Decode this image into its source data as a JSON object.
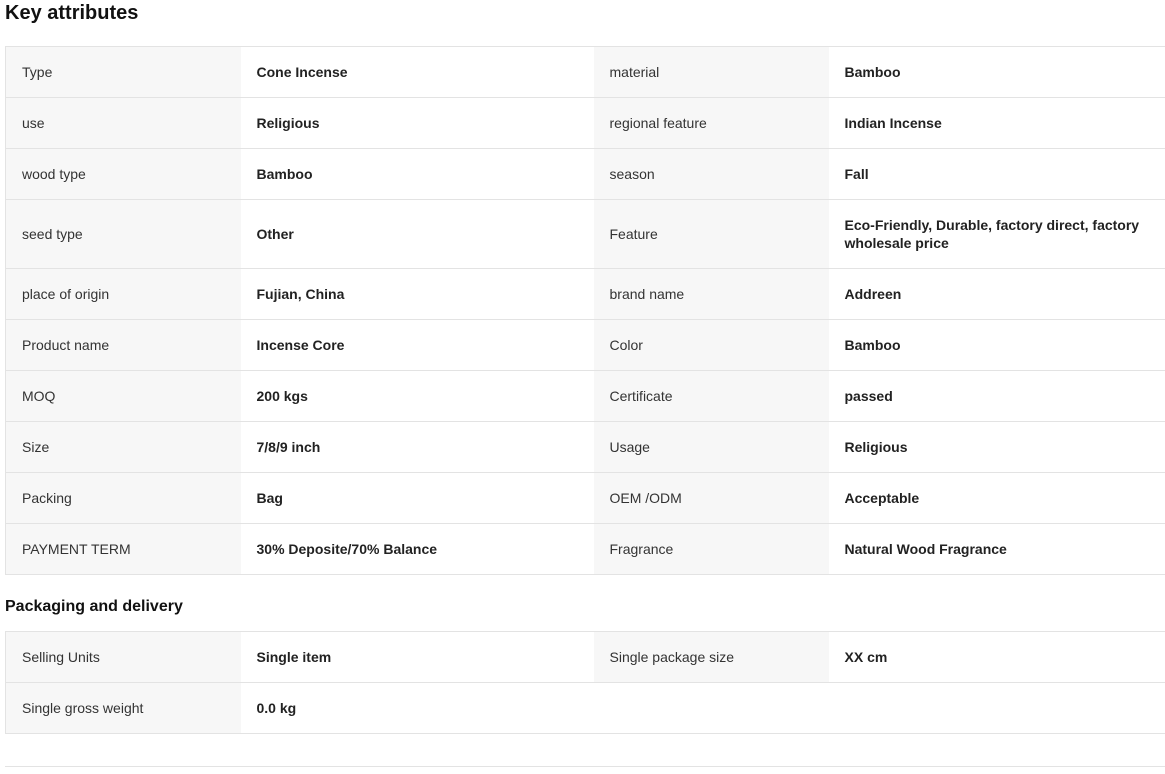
{
  "key_attributes": {
    "title": "Key attributes",
    "rows": [
      {
        "label1": "Type",
        "value1": "Cone Incense",
        "label2": "material",
        "value2": "Bamboo"
      },
      {
        "label1": "use",
        "value1": "Religious",
        "label2": "regional feature",
        "value2": "Indian Incense"
      },
      {
        "label1": "wood type",
        "value1": "Bamboo",
        "label2": "season",
        "value2": "Fall"
      },
      {
        "label1": "seed type",
        "value1": "Other",
        "label2": "Feature",
        "value2": "Eco-Friendly, Durable, factory direct, factory wholesale price"
      },
      {
        "label1": "place of origin",
        "value1": "Fujian, China",
        "label2": "brand name",
        "value2": "Addreen"
      },
      {
        "label1": "Product name",
        "value1": "Incense Core",
        "label2": "Color",
        "value2": "Bamboo"
      },
      {
        "label1": "MOQ",
        "value1": "200 kgs",
        "label2": "Certificate",
        "value2": "passed"
      },
      {
        "label1": "Size",
        "value1": "7/8/9 inch",
        "label2": "Usage",
        "value2": "Religious"
      },
      {
        "label1": "Packing",
        "value1": "Bag",
        "label2": "OEM /ODM",
        "value2": "Acceptable"
      },
      {
        "label1": "PAYMENT TERM",
        "value1": "30% Deposite/70% Balance",
        "label2": "Fragrance",
        "value2": "Natural Wood Fragrance"
      }
    ]
  },
  "packaging": {
    "title": "Packaging and delivery",
    "rows": [
      {
        "label1": "Selling Units",
        "value1": "Single item",
        "label2": "Single package size",
        "value2": "XX cm"
      },
      {
        "label1": "Single gross weight",
        "value1": "0.0 kg",
        "label2": "",
        "value2": ""
      }
    ]
  }
}
